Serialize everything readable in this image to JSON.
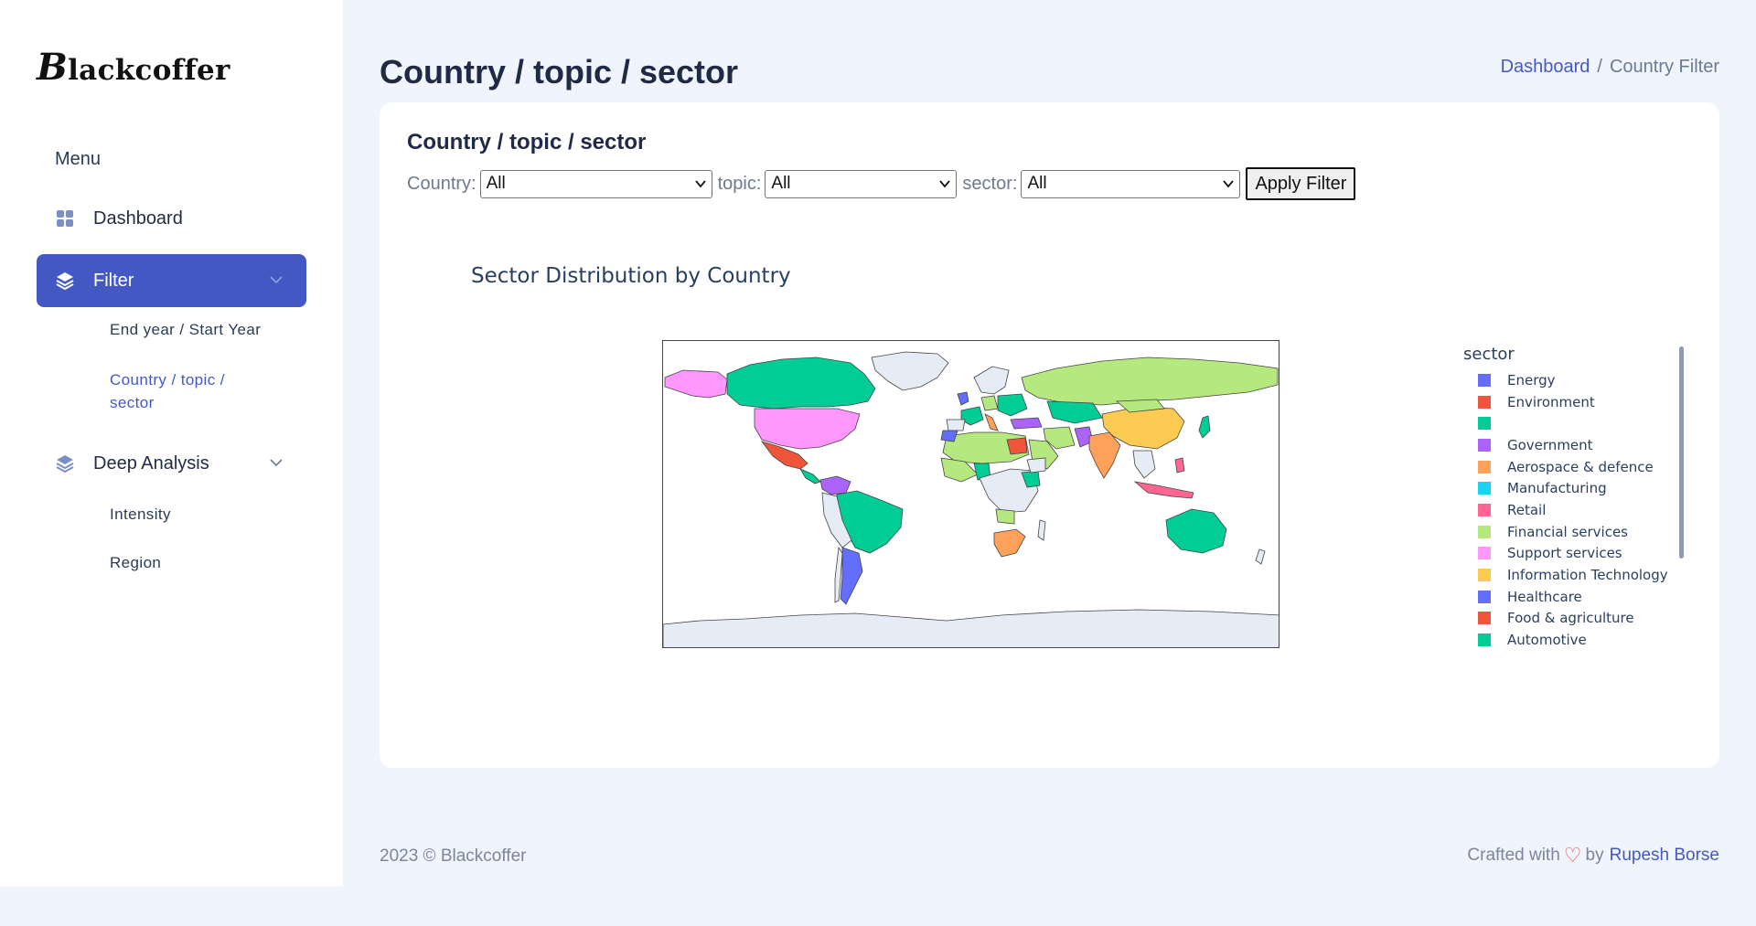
{
  "brand": {
    "logo": "Blackcoffer"
  },
  "sidebar": {
    "menu_title": "Menu",
    "items": [
      {
        "label": "Dashboard",
        "icon": "grid-icon"
      },
      {
        "label": "Filter",
        "icon": "layers-icon",
        "active": true
      },
      {
        "label": "Deep Analysis",
        "icon": "layers-icon"
      }
    ],
    "filter_sub": [
      "End year / Start Year",
      "Country / topic / sector"
    ],
    "analysis_sub": [
      "Intensity",
      "Region"
    ]
  },
  "header": {
    "title": "Country / topic / sector",
    "breadcrumb": [
      "Dashboard",
      "Country Filter"
    ]
  },
  "card": {
    "title": "Country / topic / sector",
    "filters": {
      "country_label": "Country:",
      "country_value": "All",
      "topic_label": "topic:",
      "topic_value": "All",
      "sector_label": "sector:",
      "sector_value": "All",
      "apply_label": "Apply Filter"
    }
  },
  "chart_data": {
    "type": "choropleth",
    "title": "Sector Distribution by Country",
    "legend_title": "sector",
    "legend_position": "right",
    "sectors": [
      {
        "name": "Energy",
        "color": "#636efa"
      },
      {
        "name": "Environment",
        "color": "#ef553b"
      },
      {
        "name": "",
        "color": "#00cc96"
      },
      {
        "name": "Government",
        "color": "#ab63fa"
      },
      {
        "name": "Aerospace & defence",
        "color": "#ffa15a"
      },
      {
        "name": "Manufacturing",
        "color": "#19d3f3"
      },
      {
        "name": "Retail",
        "color": "#ff6692"
      },
      {
        "name": "Financial services",
        "color": "#b6e880"
      },
      {
        "name": "Support services",
        "color": "#ff97ff"
      },
      {
        "name": "Information Technology",
        "color": "#fecb52"
      },
      {
        "name": "Healthcare",
        "color": "#636efa"
      },
      {
        "name": "Food & agriculture",
        "color": "#ef553b"
      },
      {
        "name": "Automotive",
        "color": "#00cc96"
      }
    ]
  },
  "footer": {
    "copyright": "2023 © Blackcoffer",
    "crafted": "Crafted with",
    "by": "by",
    "author": "Rupesh Borse"
  }
}
